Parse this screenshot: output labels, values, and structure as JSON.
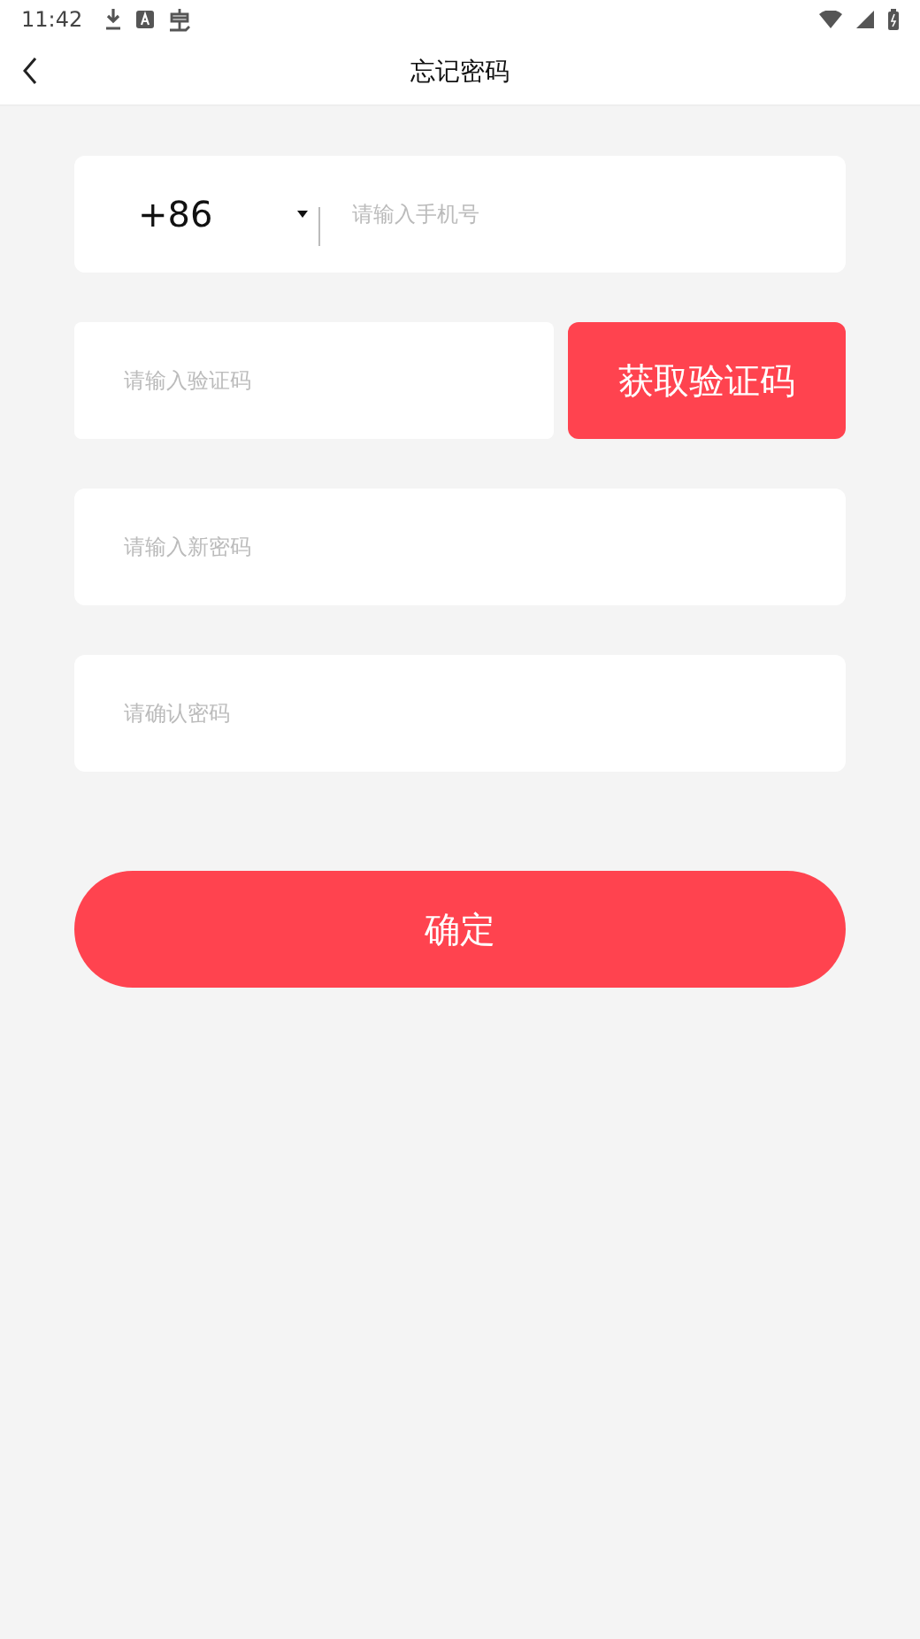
{
  "status_bar": {
    "time": "11:42"
  },
  "header": {
    "title": "忘记密码"
  },
  "phone": {
    "country_code": "+86",
    "placeholder": "请输入手机号"
  },
  "code": {
    "placeholder": "请输入验证码",
    "button": "获取验证码"
  },
  "new_password": {
    "placeholder": "请输入新密码"
  },
  "confirm_password": {
    "placeholder": "请确认密码"
  },
  "submit": "确定"
}
